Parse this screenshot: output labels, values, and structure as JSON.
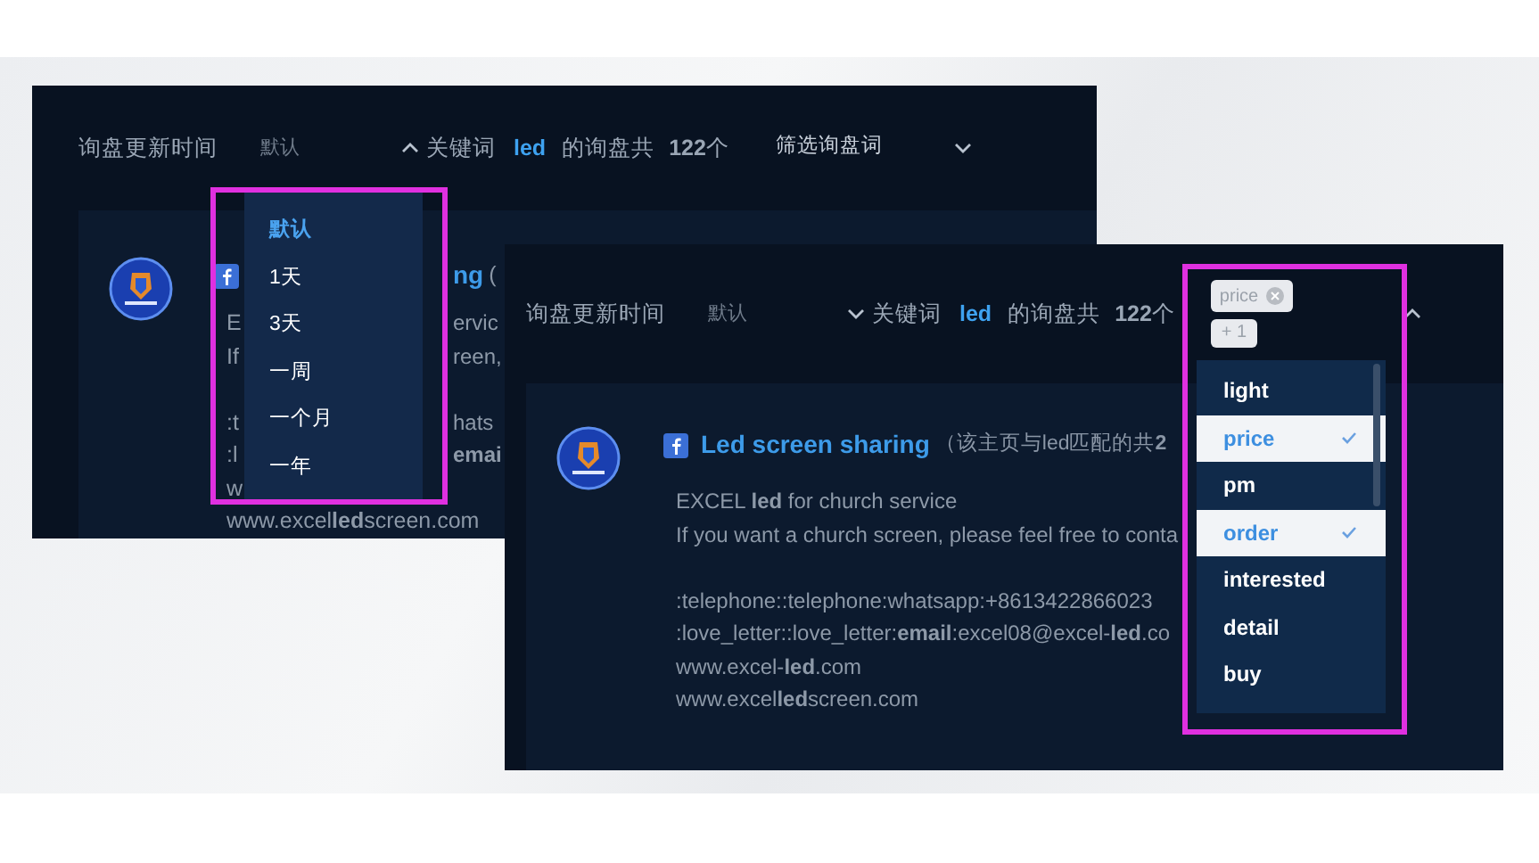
{
  "panels": [
    {
      "sort_label": "询盘更新时间",
      "sort_value": "默认",
      "sort_expanded": true,
      "keyword_prefix": "关键词",
      "keyword": "led",
      "count_prefix": "的询盘共",
      "count": "**122**个",
      "filter_label": "筛选询盘词",
      "filter_expanded": false,
      "post": {
        "title": "ng",
        "title_suffix": "(",
        "paragraphs": [
          [
            {
              "left": "E",
              "right": "ervic"
            },
            {
              "left": "If",
              "right": "reen,"
            }
          ],
          [
            {
              "left": ":t",
              "right": "hats"
            },
            {
              "left": ":l",
              "right": "**emai**"
            },
            {
              "left": "w"
            },
            {
              "left": "www.excel**led**screen.com"
            }
          ]
        ]
      },
      "menu": [
        {
          "label": "默认",
          "selected": true
        },
        {
          "label": "1天",
          "selected": false
        },
        {
          "label": "3天",
          "selected": false
        },
        {
          "label": "一周",
          "selected": false
        },
        {
          "label": "一个月",
          "selected": false
        },
        {
          "label": "一年",
          "selected": false
        }
      ]
    },
    {
      "sort_label": "询盘更新时间",
      "sort_value": "默认",
      "sort_expanded": false,
      "keyword_prefix": "关键词",
      "keyword": "led",
      "count_prefix": "的询盘共",
      "count": "**122**个",
      "filter_expanded": true,
      "filter_tags": [
        "price"
      ],
      "filter_more": "+ 1",
      "post": {
        "title": "Led screen sharing",
        "title_suffix": "（该主页与led匹配的共**2**",
        "paragraphs": [
          [
            "EXCEL **led** for church service",
            "If you want a church screen, please feel free to conta"
          ],
          [
            ":telephone::telephone:whatsapp:+8613422866023",
            ":love_letter::love_letter:**email**:excel08@excel-**led**.co",
            "www.excel-**led**.com",
            "www.excel**led**screen.com"
          ]
        ]
      },
      "menu": [
        {
          "label": "light",
          "selected": false
        },
        {
          "label": "price",
          "selected": true
        },
        {
          "label": "pm",
          "selected": false
        },
        {
          "label": "order",
          "selected": true
        },
        {
          "label": "interested",
          "selected": false
        },
        {
          "label": "detail",
          "selected": false
        },
        {
          "label": "buy",
          "selected": false
        }
      ]
    }
  ]
}
